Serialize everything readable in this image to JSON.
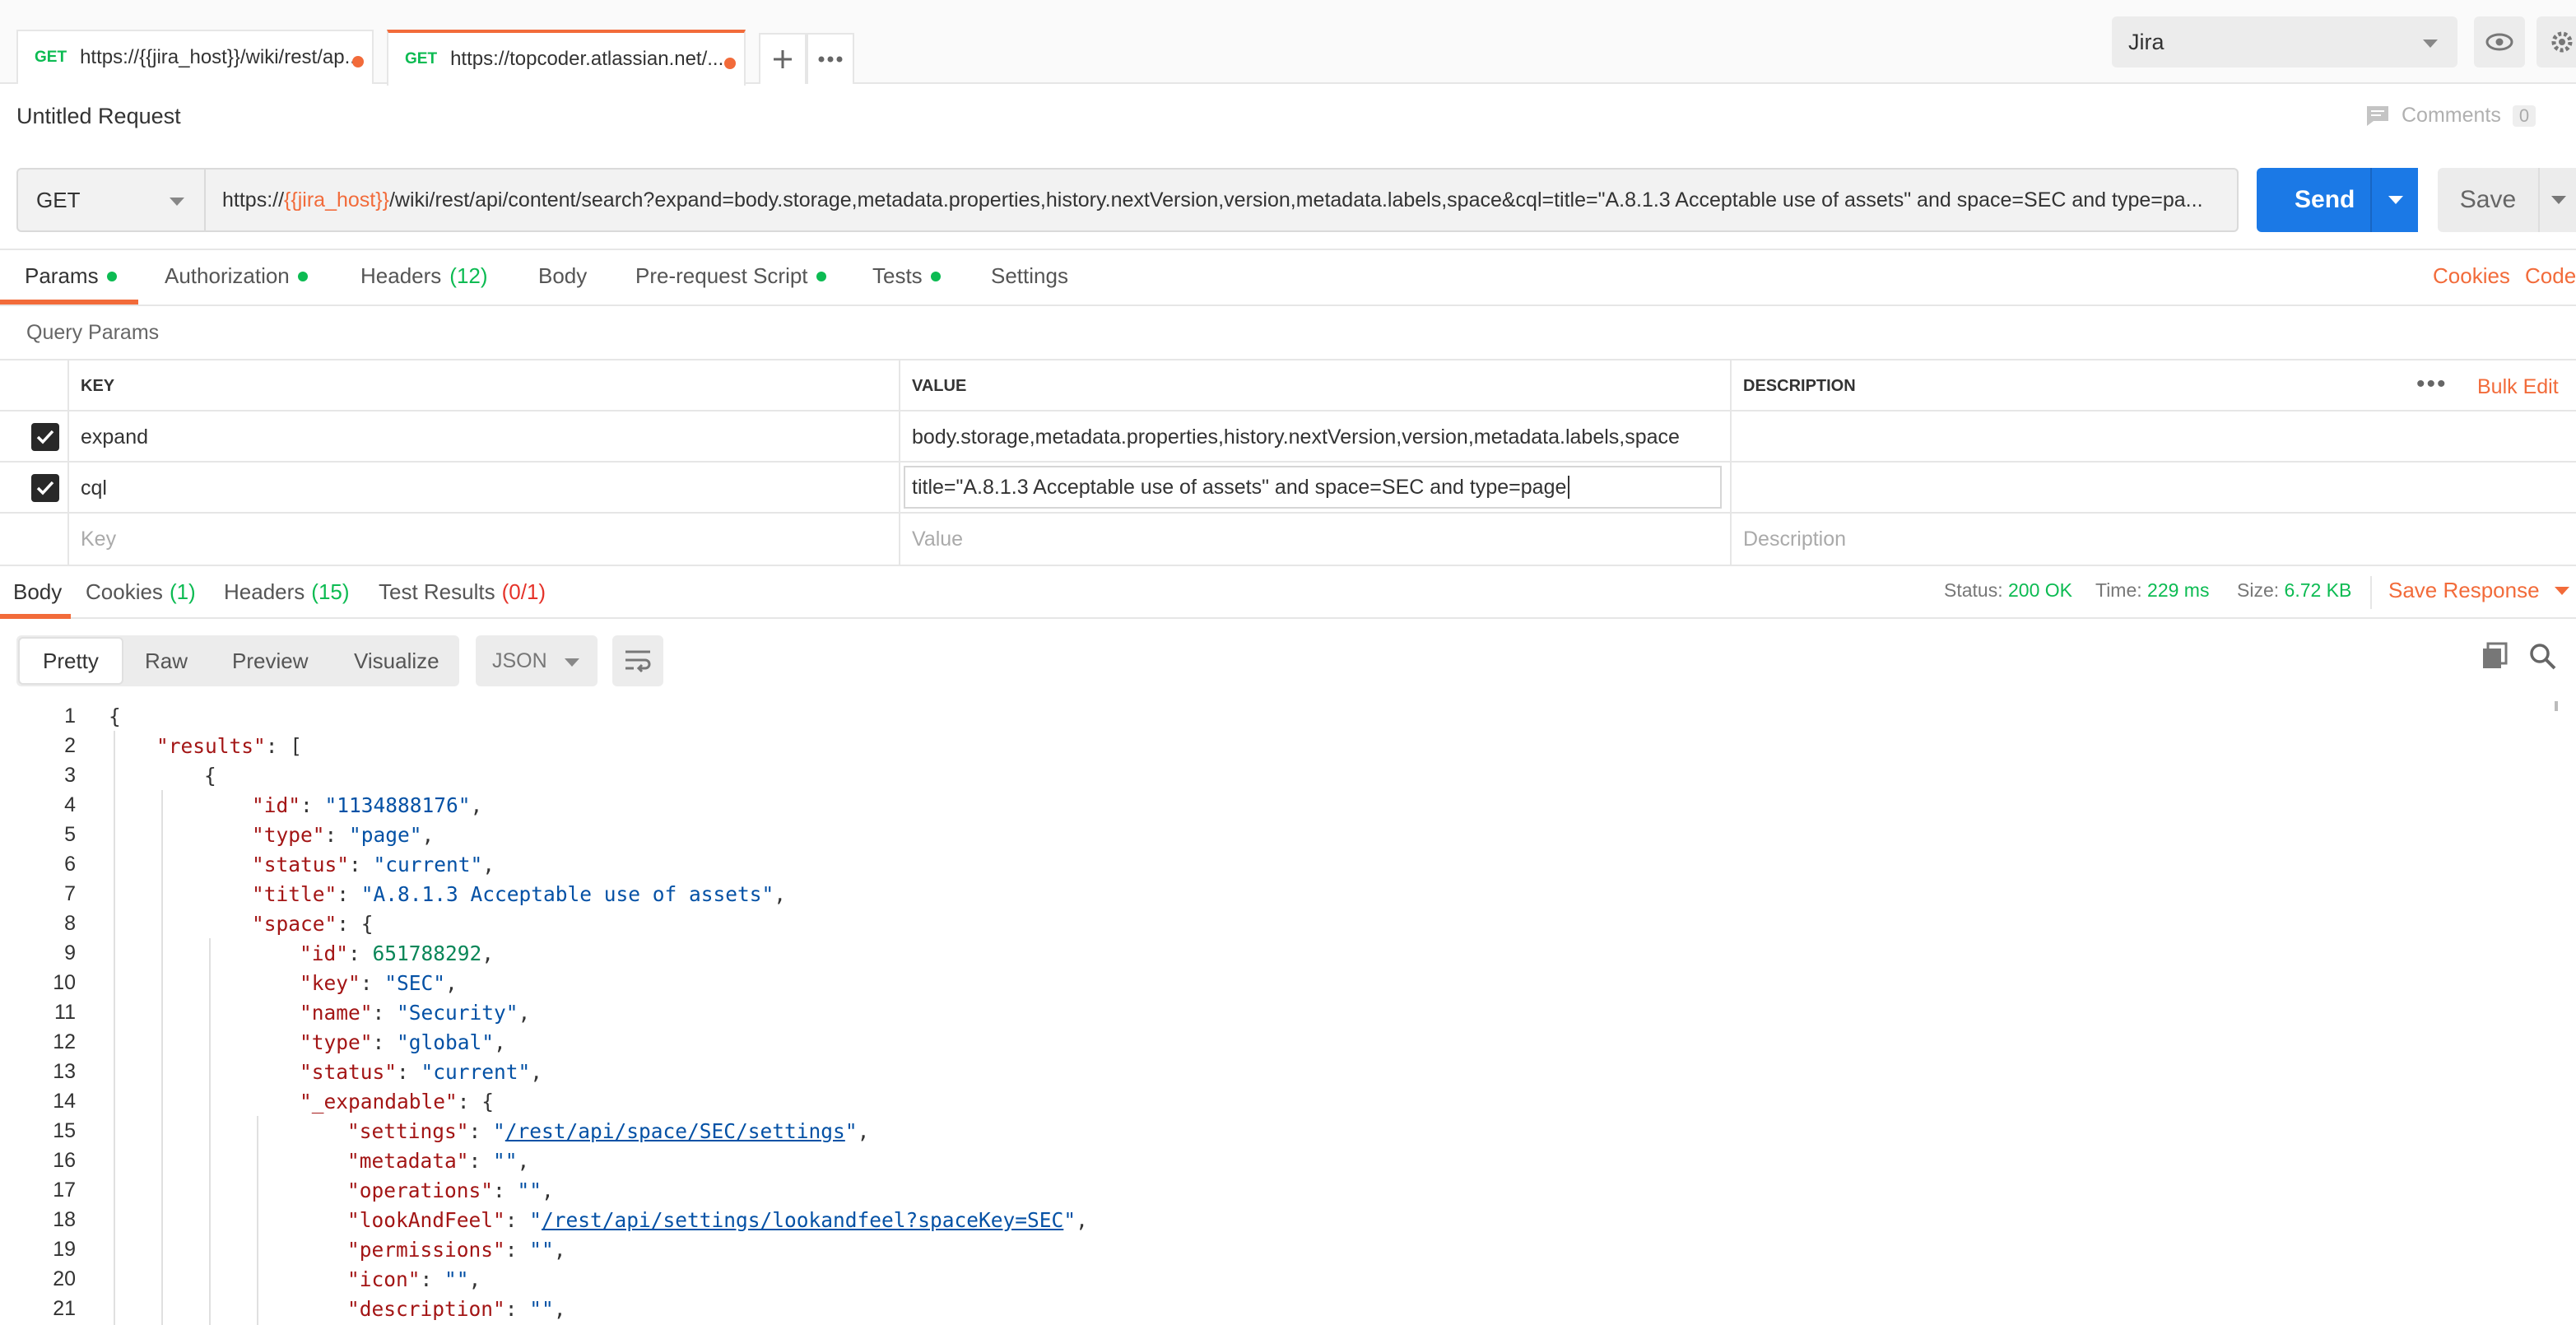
{
  "tabs": [
    {
      "method": "GET",
      "url": "https://{{jira_host}}/wiki/rest/ap..."
    },
    {
      "method": "GET",
      "url": "https://topcoder.atlassian.net/..."
    }
  ],
  "environment": {
    "selected": "Jira"
  },
  "request": {
    "title": "Untitled Request",
    "comments_label": "Comments",
    "comments_count": "0",
    "method": "GET",
    "url_prefix": "https://",
    "url_var": "{{jira_host}}",
    "url_rest": "/wiki/rest/api/content/search?expand=body.storage,metadata.properties,history.nextVersion,version,metadata.labels,space&cql=title=\"A.8.1.3 Acceptable use of assets\" and space=SEC and type=pa...",
    "send_label": "Send",
    "save_label": "Save"
  },
  "request_tabs": {
    "params": "Params",
    "authorization": "Authorization",
    "headers": "Headers",
    "headers_count": "(12)",
    "body": "Body",
    "prerequest": "Pre-request Script",
    "tests": "Tests",
    "settings": "Settings",
    "cookies": "Cookies",
    "code": "Code"
  },
  "params": {
    "section_label": "Query Params",
    "columns": {
      "key": "KEY",
      "value": "VALUE",
      "description": "DESCRIPTION"
    },
    "bulk_edit": "Bulk Edit",
    "rows": [
      {
        "key": "expand",
        "value": "body.storage,metadata.properties,history.nextVersion,version,metadata.labels,space",
        "description": ""
      },
      {
        "key": "cql",
        "value": "title=\"A.8.1.3 Acceptable use of assets\" and space=SEC and type=page",
        "description": ""
      }
    ],
    "placeholder": {
      "key": "Key",
      "value": "Value",
      "description": "Description"
    }
  },
  "response": {
    "tabs": {
      "body": "Body",
      "cookies": "Cookies",
      "cookies_count": "(1)",
      "headers": "Headers",
      "headers_count": "(15)",
      "tests": "Test Results",
      "tests_count": "(0/1)"
    },
    "status_label": "Status:",
    "status_value": "200 OK",
    "time_label": "Time:",
    "time_value": "229 ms",
    "size_label": "Size:",
    "size_value": "6.72 KB",
    "save_response": "Save Response",
    "views": {
      "pretty": "Pretty",
      "raw": "Raw",
      "preview": "Preview",
      "visualize": "Visualize"
    },
    "format": "JSON"
  },
  "code_lines": [
    "{",
    "\"results\": [",
    "{",
    "\"id\": \"1134888176\",",
    "\"type\": \"page\",",
    "\"status\": \"current\",",
    "\"title\": \"A.8.1.3 Acceptable use of assets\",",
    "\"space\": {",
    "\"id\": 651788292,",
    "\"key\": \"SEC\",",
    "\"name\": \"Security\",",
    "\"type\": \"global\",",
    "\"status\": \"current\",",
    "\"_expandable\": {",
    "\"settings\": \"/rest/api/space/SEC/settings\",",
    "\"metadata\": \"\",",
    "\"operations\": \"\",",
    "\"lookAndFeel\": \"/rest/api/settings/lookandfeel?spaceKey=SEC\",",
    "\"permissions\": \"\",",
    "\"icon\": \"\",",
    "\"description\": \"\","
  ],
  "colors": {
    "accent": "#f26b3a",
    "send": "#1b79e6",
    "ok": "#0cbb52",
    "error": "#e5332a"
  }
}
